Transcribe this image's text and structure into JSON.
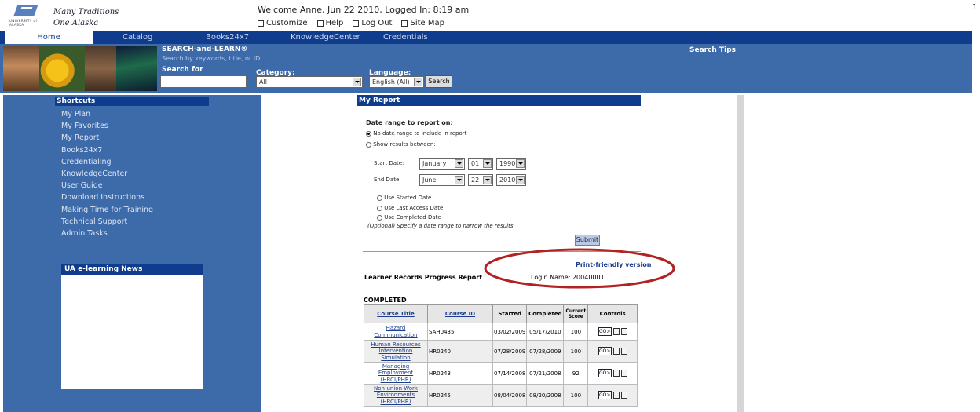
{
  "header": {
    "logo_text": "UNIVERSITY of ALASKA",
    "tagline1": "Many Traditions",
    "tagline2": "One Alaska",
    "welcome": "Welcome  Anne,  Jun 22 2010,  Logged In:  8:19 am",
    "links": [
      "Customize",
      "Help",
      "Log Out",
      "Site Map"
    ],
    "edge_mark": "1"
  },
  "nav": {
    "tabs": [
      "Home",
      "Catalog",
      "Books24x7",
      "KnowledgeCenter",
      "Credentials"
    ]
  },
  "search": {
    "title": "SEARCH-and-LEARN®",
    "subtitle": "Search by keywords, title, or ID",
    "search_for_label": "Search for",
    "search_value": "",
    "category_label": "Category:",
    "category_value": "All",
    "language_label": "Language:",
    "language_value": "English (All)",
    "button": "Search",
    "tips": "Search Tips"
  },
  "sidebar": {
    "shortcuts_title": "Shortcuts",
    "items": [
      "My Plan",
      "My Favorites",
      "My Report",
      "Books24x7",
      "Credentialing",
      "KnowledgeCenter",
      "User Guide",
      "Download Instructions",
      "Making Time for Training",
      "Technical Support",
      "Admin Tasks"
    ],
    "news_title": "UA e-learning News"
  },
  "report": {
    "title": "My Report",
    "date_range_label": "Date range to report on:",
    "opt_none": "No date range to include in report",
    "opt_between": "Show results between:",
    "start_label": "Start Date:",
    "start_month": "January",
    "start_day": "01",
    "start_year": "1990",
    "end_label": "End Date:",
    "end_month": "June",
    "end_day": "22",
    "end_year": "2010",
    "use_started": "Use Started Date",
    "use_last": "Use Last Access Date",
    "use_completed": "Use Completed Date",
    "optional_note": "(Optional) Specify a date range to narrow the results",
    "submit": "Submit",
    "print_friendly": "Print-friendly version",
    "lrpr": "Learner Records Progress Report",
    "login_name": "Login Name: 20040001",
    "completed_label": "COMPLETED",
    "columns": [
      "Course Title",
      "Course ID",
      "Started",
      "Completed",
      "Current Score",
      "Controls"
    ],
    "rows": [
      {
        "title": "Hazard Communication",
        "id": "SAH0435",
        "started": "03/02/2009",
        "completed": "05/17/2010",
        "score": "100"
      },
      {
        "title": "Human Resources Intervention Simulation",
        "id": "HR0240",
        "started": "07/28/2009",
        "completed": "07/28/2009",
        "score": "100"
      },
      {
        "title": "Managing Employment (HRCI/PHR)",
        "id": "HR0243",
        "started": "07/14/2008",
        "completed": "07/21/2008",
        "score": "92"
      },
      {
        "title": "Non-union Work Environments (HRCI/PHR)",
        "id": "HR0245",
        "started": "08/04/2008",
        "completed": "08/20/2008",
        "score": "100"
      }
    ],
    "go_label": "GO>"
  },
  "colors": {
    "nav": "#0f3c8c",
    "band": "#3d6aa8",
    "oval": "#b22222"
  }
}
